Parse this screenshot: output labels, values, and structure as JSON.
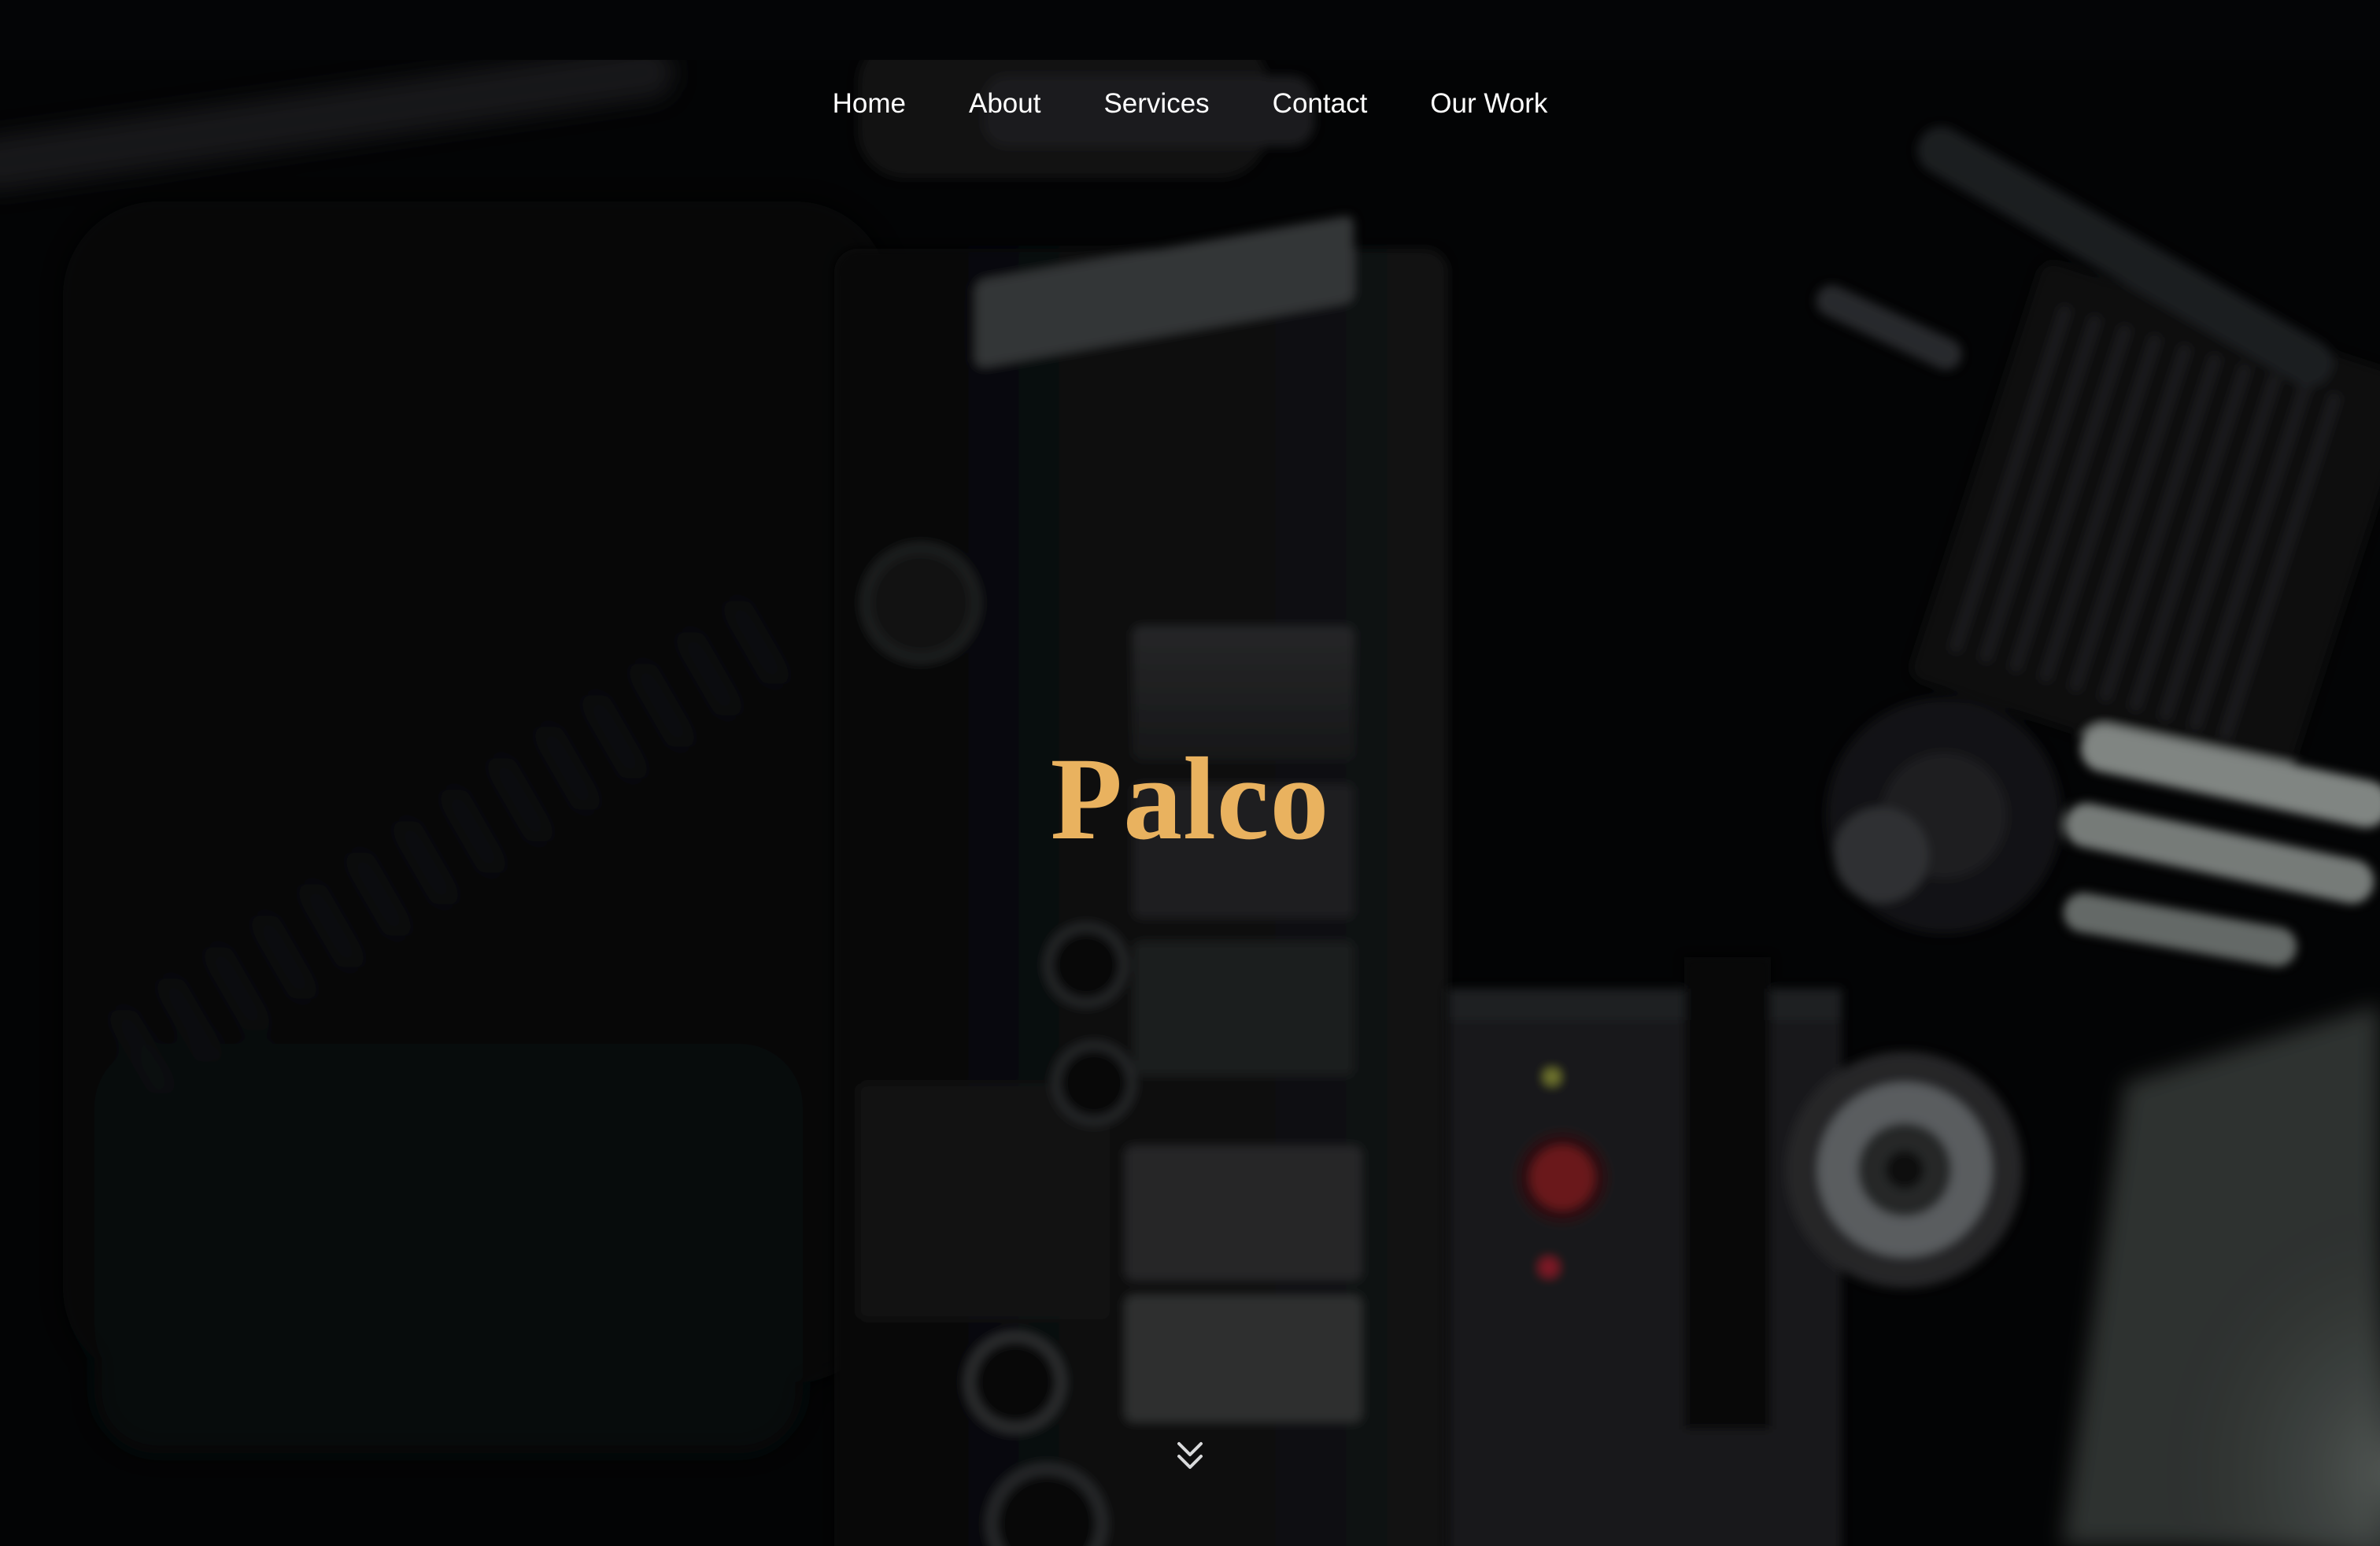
{
  "nav": {
    "items": [
      {
        "label": "Home"
      },
      {
        "label": "About"
      },
      {
        "label": "Services"
      },
      {
        "label": "Contact"
      },
      {
        "label": "Our Work"
      }
    ]
  },
  "hero": {
    "title": "Palco",
    "background_subject": "dimly lit cinema camera close-up",
    "scroll_icon": "double-chevron-down-icon"
  },
  "colors": {
    "page_background": "#040506",
    "title": "#e9b25f",
    "nav_text": "#ffffff",
    "accent_red": "#a3262a"
  }
}
